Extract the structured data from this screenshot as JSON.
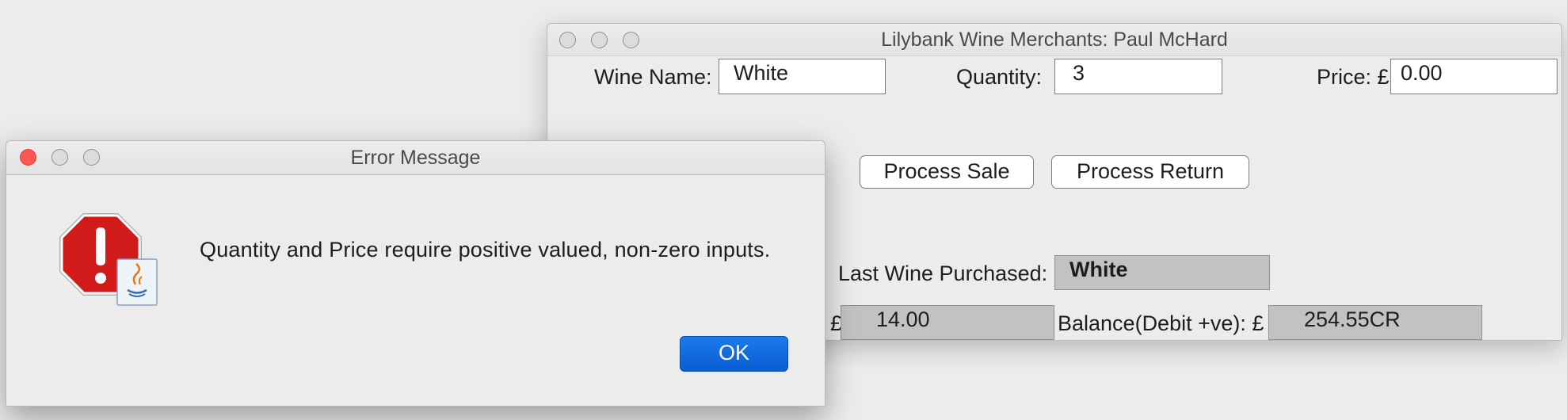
{
  "main_window": {
    "title": "Lilybank Wine Merchants: Paul McHard",
    "wine_name_label": "Wine Name:",
    "wine_name_value": "White",
    "quantity_label": "Quantity:",
    "quantity_value": "3",
    "price_label": "Price: £",
    "price_value": "0.00",
    "process_sale_label": "Process Sale",
    "process_return_label": "Process Return",
    "last_wine_label": "Last Wine Purchased:",
    "last_wine_value": "White",
    "amount_currency": "£",
    "amount_value": "14.00",
    "balance_label": "Balance(Debit +ve): £",
    "balance_value": "254.55CR"
  },
  "dialog": {
    "title": "Error Message",
    "message": "Quantity and Price require positive valued, non-zero inputs.",
    "ok_label": "OK"
  },
  "colors": {
    "accent_button": "#0a5ed0",
    "close_button": "#fc5753",
    "error_icon": "#d11a1a"
  }
}
